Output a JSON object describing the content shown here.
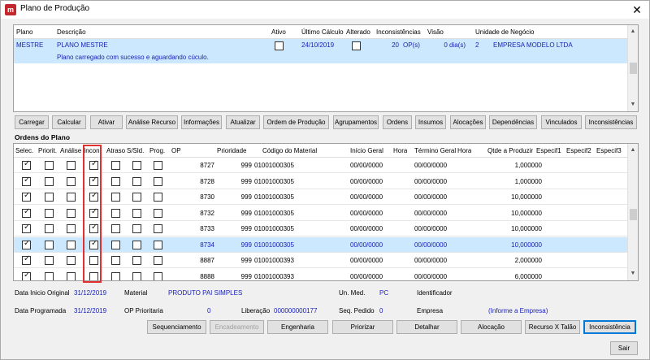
{
  "window": {
    "title": "Plano de Produção",
    "app_icon": "fm-logo-icon",
    "close_glyph": "✕"
  },
  "plan_grid": {
    "headers": [
      "Plano",
      "Descrição",
      "Ativo",
      "Último Cálculo",
      "Alterado",
      "Inconsistências",
      "Visão",
      "Unidade de Negócio"
    ],
    "row": {
      "plano": "MESTRE",
      "descricao": "PLANO MESTRE",
      "descricao_status": "Plano carregado com sucesso e aguardando cúculo.",
      "ativo": false,
      "ultimo_calculo": "24/10/2019",
      "alterado": false,
      "inconsistencias": "20",
      "op": "OP(s)",
      "visao": "0 dia(s)",
      "unidade_num": "2",
      "unidade_nome": "EMPRESA MODELO LTDA"
    }
  },
  "plan_buttons": [
    {
      "label": "Carregar"
    },
    {
      "label": "Calcular"
    },
    {
      "label": "Ativar"
    },
    {
      "label": "Análise Recurso"
    },
    {
      "label": "Informações"
    },
    {
      "label": "Atualizar"
    },
    {
      "label": "Ordem de Produção"
    },
    {
      "label": "Agrupamentos"
    },
    {
      "label": "Ordens"
    },
    {
      "label": "Insumos"
    },
    {
      "label": "Alocações"
    },
    {
      "label": "Dependências"
    },
    {
      "label": "Vinculados"
    },
    {
      "label": "Inconsistências"
    }
  ],
  "orders": {
    "section_title": "Ordens do Plano",
    "headers": [
      "Selec.",
      "Priorit.",
      "Análise",
      "Incon.",
      "Atraso",
      "S/Sld.",
      "Prog.",
      "OP",
      "Prioridade",
      "Código do Material",
      "Início Geral",
      "Hora",
      "Término Geral",
      "Hora",
      "Qtde a Produzir",
      "Especif1",
      "Especif2",
      "Especif3"
    ],
    "rows": [
      {
        "selec": true,
        "priorit": false,
        "analise": false,
        "incon": true,
        "atraso": false,
        "ssld": false,
        "prog": false,
        "op": "8727",
        "prioridade": "999",
        "codigo": "01001000305",
        "inicio": "00/00/0000",
        "termino": "00/00/0000",
        "qtde": "1,000000"
      },
      {
        "selec": true,
        "priorit": false,
        "analise": false,
        "incon": true,
        "atraso": false,
        "ssld": false,
        "prog": false,
        "op": "8728",
        "prioridade": "999",
        "codigo": "01001000305",
        "inicio": "00/00/0000",
        "termino": "00/00/0000",
        "qtde": "1,000000"
      },
      {
        "selec": true,
        "priorit": false,
        "analise": false,
        "incon": true,
        "atraso": false,
        "ssld": false,
        "prog": false,
        "op": "8730",
        "prioridade": "999",
        "codigo": "01001000305",
        "inicio": "00/00/0000",
        "termino": "00/00/0000",
        "qtde": "10,000000"
      },
      {
        "selec": true,
        "priorit": false,
        "analise": false,
        "incon": true,
        "atraso": false,
        "ssld": false,
        "prog": false,
        "op": "8732",
        "prioridade": "999",
        "codigo": "01001000305",
        "inicio": "00/00/0000",
        "termino": "00/00/0000",
        "qtde": "10,000000"
      },
      {
        "selec": true,
        "priorit": false,
        "analise": false,
        "incon": true,
        "atraso": false,
        "ssld": false,
        "prog": false,
        "op": "8733",
        "prioridade": "999",
        "codigo": "01001000305",
        "inicio": "00/00/0000",
        "termino": "00/00/0000",
        "qtde": "10,000000"
      },
      {
        "selec": true,
        "priorit": false,
        "analise": false,
        "incon": true,
        "atraso": false,
        "ssld": false,
        "prog": false,
        "op": "8734",
        "prioridade": "999",
        "codigo": "01001000305",
        "inicio": "00/00/0000",
        "termino": "00/00/0000",
        "qtde": "10,000000",
        "selected": true
      },
      {
        "selec": true,
        "priorit": false,
        "analise": false,
        "incon": false,
        "atraso": false,
        "ssld": false,
        "prog": false,
        "op": "8887",
        "prioridade": "999",
        "codigo": "01001000393",
        "inicio": "00/00/0000",
        "termino": "00/00/0000",
        "qtde": "2,000000"
      },
      {
        "selec": true,
        "priorit": false,
        "analise": false,
        "incon": false,
        "atraso": false,
        "ssld": false,
        "prog": false,
        "op": "8888",
        "prioridade": "999",
        "codigo": "01001000393",
        "inicio": "00/00/0000",
        "termino": "00/00/0000",
        "qtde": "6,000000"
      }
    ]
  },
  "details": {
    "data_inicio_label": "Data Inicio Original",
    "data_inicio_value": "31/12/2019",
    "material_label": "Material",
    "material_value": "PRODUTO PAI SIMPLES",
    "un_med_label": "Un. Med.",
    "un_med_value": "PC",
    "identificador_label": "Identificador",
    "data_prog_label": "Data Programada",
    "data_prog_value": "31/12/2019",
    "op_prio_label": "OP Prioritaria",
    "op_prio_value": "0",
    "liberacao_label": "Liberação",
    "liberacao_value": "000000000177",
    "seq_pedido_label": "Seq. Pedido",
    "seq_pedido_value": "0",
    "empresa_label": "Empresa",
    "empresa_value": "(Informe a Empresa)"
  },
  "bottom_buttons": [
    {
      "label": "Sequenciamento"
    },
    {
      "label": "Encadeamento"
    },
    {
      "label": "Engenharia"
    },
    {
      "label": "Priorizar"
    },
    {
      "label": "Detalhar"
    },
    {
      "label": "Alocação"
    },
    {
      "label": "Recurso X Talão"
    },
    {
      "label": "Inconsistência"
    }
  ],
  "exit_button": "Sair"
}
